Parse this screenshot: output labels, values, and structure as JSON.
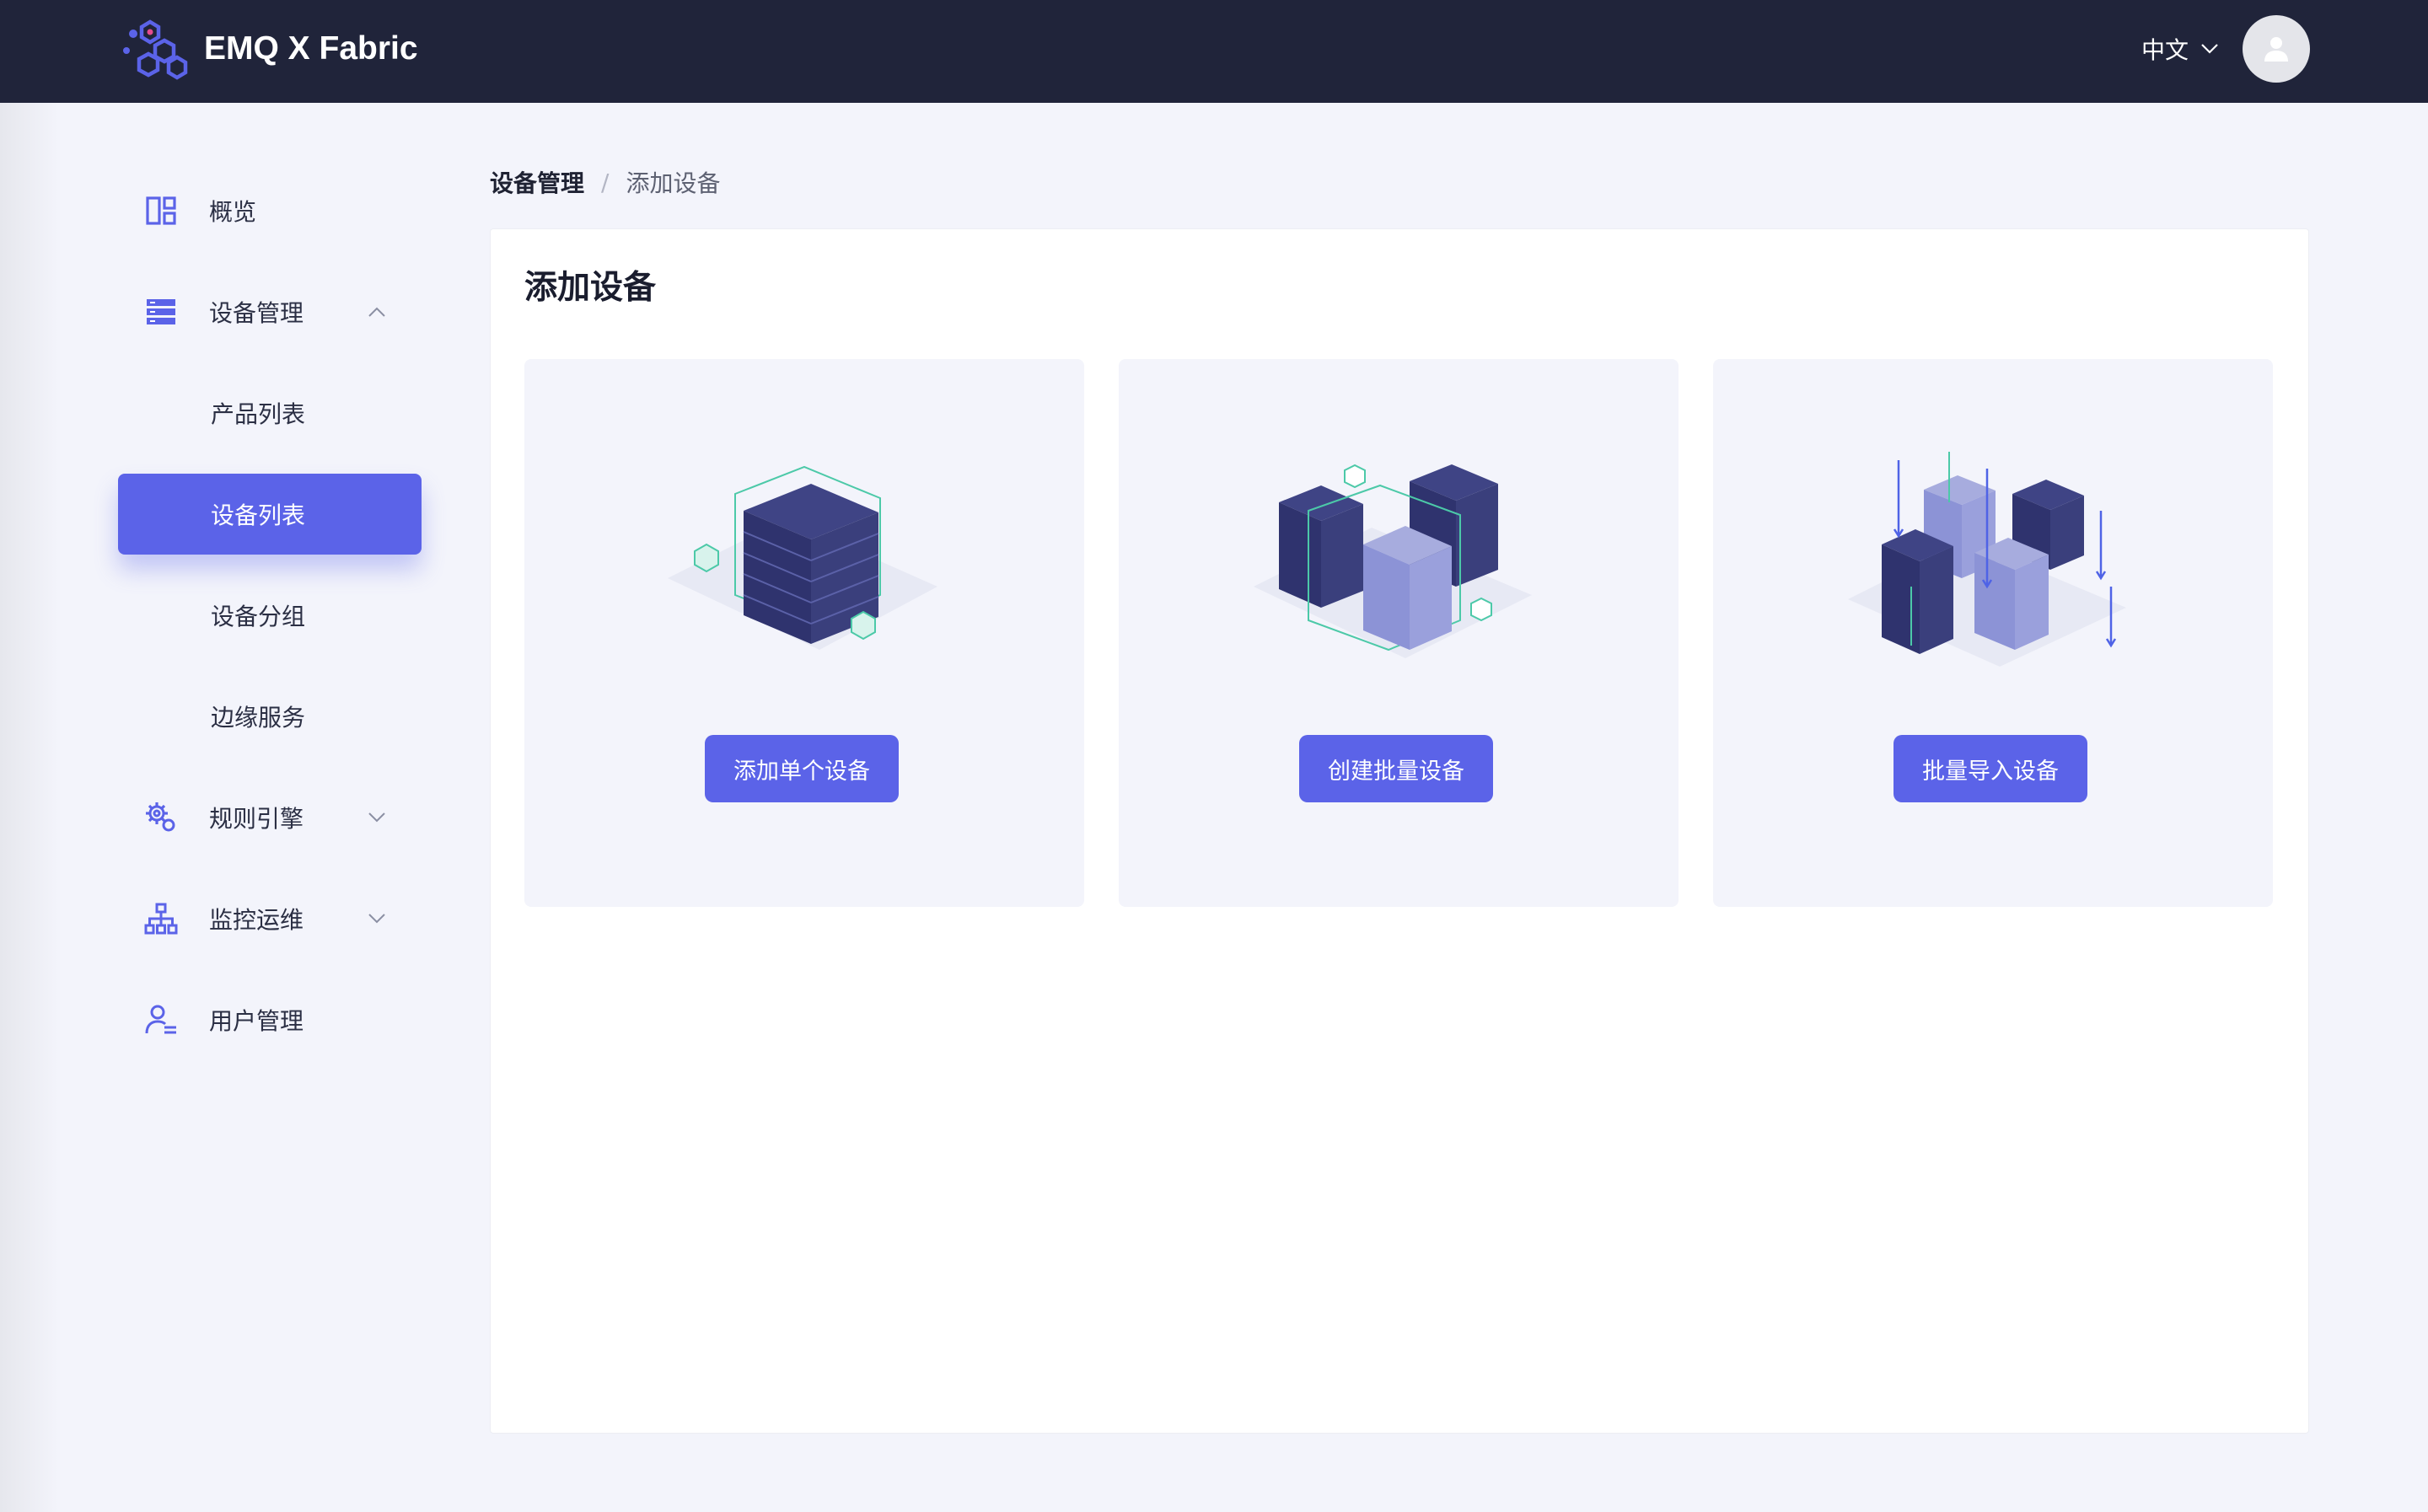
{
  "header": {
    "brand": "EMQ X Fabric",
    "language": "中文",
    "logo_icon": "hexagon-cluster-logo",
    "avatar_icon": "user-icon",
    "background": "#20243a"
  },
  "sidebar": {
    "overview": {
      "label": "概览",
      "icon": "dashboard-icon"
    },
    "device_management": {
      "label": "设备管理",
      "icon": "server-list-icon",
      "expanded": true,
      "children": {
        "product_list": "产品列表",
        "device_list": "设备列表",
        "device_group": "设备分组",
        "edge_service": "边缘服务"
      },
      "active_child": "设备列表"
    },
    "rule_engine": {
      "label": "规则引擎",
      "icon": "gears-icon"
    },
    "monitoring": {
      "label": "监控运维",
      "icon": "org-chart-icon"
    },
    "user_management": {
      "label": "用户管理",
      "icon": "user-card-icon"
    }
  },
  "breadcrumb": {
    "parent": "设备管理",
    "separator": "/",
    "current": "添加设备"
  },
  "main": {
    "title": "添加设备",
    "cards": [
      {
        "illustration": "single-server-stack-illustration",
        "button": "添加单个设备"
      },
      {
        "illustration": "batch-server-stacks-illustration",
        "button": "创建批量设备"
      },
      {
        "illustration": "import-server-stacks-illustration",
        "button": "批量导入设备"
      }
    ]
  },
  "colors": {
    "accent": "#5b63e8",
    "page_bg": "#f3f4fb",
    "card_bg": "#f3f4fb",
    "server_dark": "#2f336e",
    "server_light": "#8c93d6",
    "outline_teal": "#4cc9a8"
  }
}
